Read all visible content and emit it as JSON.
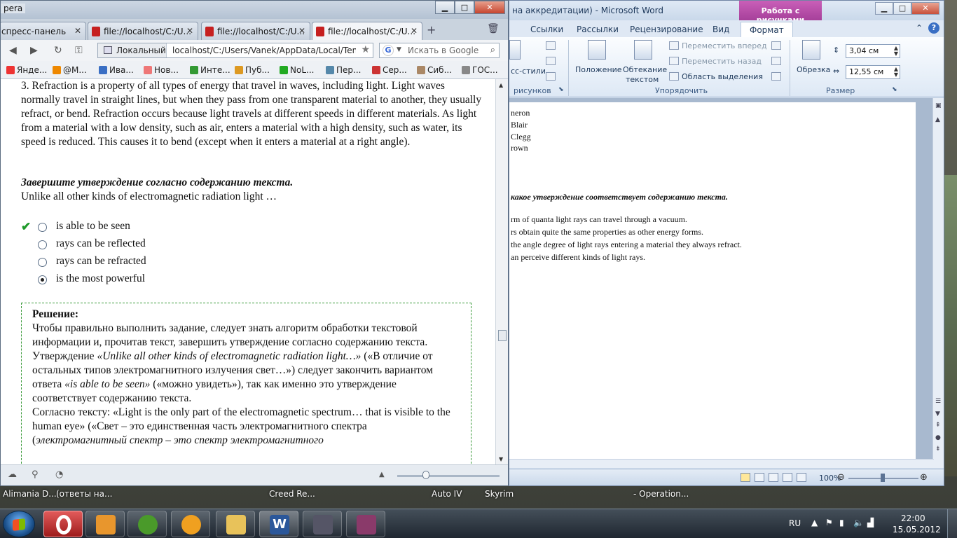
{
  "word": {
    "title": "на аккредитации) - Microsoft Word",
    "context_tab": "Работа с рисунками",
    "tabs": [
      "Ссылки",
      "Рассылки",
      "Рецензирование",
      "Вид",
      "Формат"
    ],
    "ribbon": {
      "styles_partial": "сс-стили",
      "pictures_group_partial": "рисунков",
      "position": "Положение",
      "wrap_line1": "Обтекание",
      "wrap_line2": "текстом",
      "bring_forward": "Переместить вперед",
      "send_backward": "Переместить назад",
      "selection_pane": "Область выделения",
      "arrange_group": "Упорядочить",
      "crop": "Обрезка",
      "height": "3,04 см",
      "width": "12,55 см",
      "size_group": "Размер"
    },
    "page_lines": [
      "neron",
      "Blair",
      "Clegg",
      "rown"
    ],
    "page_question": "какое утверждение соответствует содержанию текста.",
    "page_options": [
      "rm of quanta light rays can travel through a vacuum.",
      "rs obtain quite the same properties as other energy forms.",
      "the angle degree of light rays entering a material they always refract.",
      "an perceive different kinds of light rays."
    ],
    "zoom": "100%"
  },
  "opera": {
    "title": "pera",
    "tabs": [
      {
        "label": "спресс-панель"
      },
      {
        "label": "file://localhost/C:/U..."
      },
      {
        "label": "file://localhost/C:/U..."
      },
      {
        "label": "file://localhost/C:/U..."
      }
    ],
    "address_badge": "Локальный",
    "url": "localhost/C:/Users/Vanek/AppData/Local/Temp/F",
    "search_placeholder": "Искать в Google",
    "bookmarks": [
      "Янде...",
      "@M...",
      "Ива...",
      "Нов...",
      "Инте...",
      "Пуб...",
      "NoL...",
      "Пер...",
      "Сер...",
      "Сиб...",
      "ГОС..."
    ],
    "paragraph": "3. Refraction is a property of all types of energy that travel in waves, including light. Light waves normally travel in straight lines, but when they pass from one transparent material to another, they usually refract, or bend. Refraction occurs because light travels at different speeds in different materials. As light from a material with a low density, such as air, enters a material with a high density, such as water, its speed is reduced. This causes it to bend (except when it enters a material at a right angle).",
    "task": "Завершите утверждение согласно содержанию текста.",
    "stem": "Unlike all other kinds of electromagnetic radiation light …",
    "options": [
      {
        "label": "is able to be seen",
        "correct": true,
        "selected": false
      },
      {
        "label": "rays can be reflected",
        "correct": false,
        "selected": false
      },
      {
        "label": "rays can be refracted",
        "correct": false,
        "selected": false
      },
      {
        "label": "is the most powerful",
        "correct": false,
        "selected": true
      }
    ],
    "solution": {
      "heading": "Решение:",
      "p1": "Чтобы правильно выполнить задание, следует знать алгоритм обработки текстовой информации и, прочитав текст, завершить утверждение согласно содержанию текста.",
      "p2a": "Утверждение ",
      "p2b": "«Unlike all other kinds of electromagnetic radiation light…»",
      "p2c": " («В отличие от остальных типов электромагнитного излучения свет…») следует закончить вариантом ответа ",
      "p2d": "«is able to be seen»",
      "p2e": " («можно увидеть»), так как именно это утверждение соответствует содержанию текста.",
      "p3a": "Согласно тексту: «Light is the only part of the electromagnetic spectrum… that is visible to the human eye» («Свет – это единственная часть электромагнитного спектра (",
      "p3b": "электромагнитный спектр – это спектр электромагнитного"
    }
  },
  "taskbar_labels": [
    "Alimania D...",
    "(ответы на...",
    "Creed Re...",
    "Auto IV",
    "Skyrim",
    "- Operation..."
  ],
  "tray": {
    "lang": "RU",
    "time": "22:00",
    "date": "15.05.2012"
  },
  "colors": {
    "opera_red": "#c62020",
    "word_blue": "#2b579a",
    "check_green": "#1e9a2a",
    "solution_border": "#3a9a3a"
  }
}
